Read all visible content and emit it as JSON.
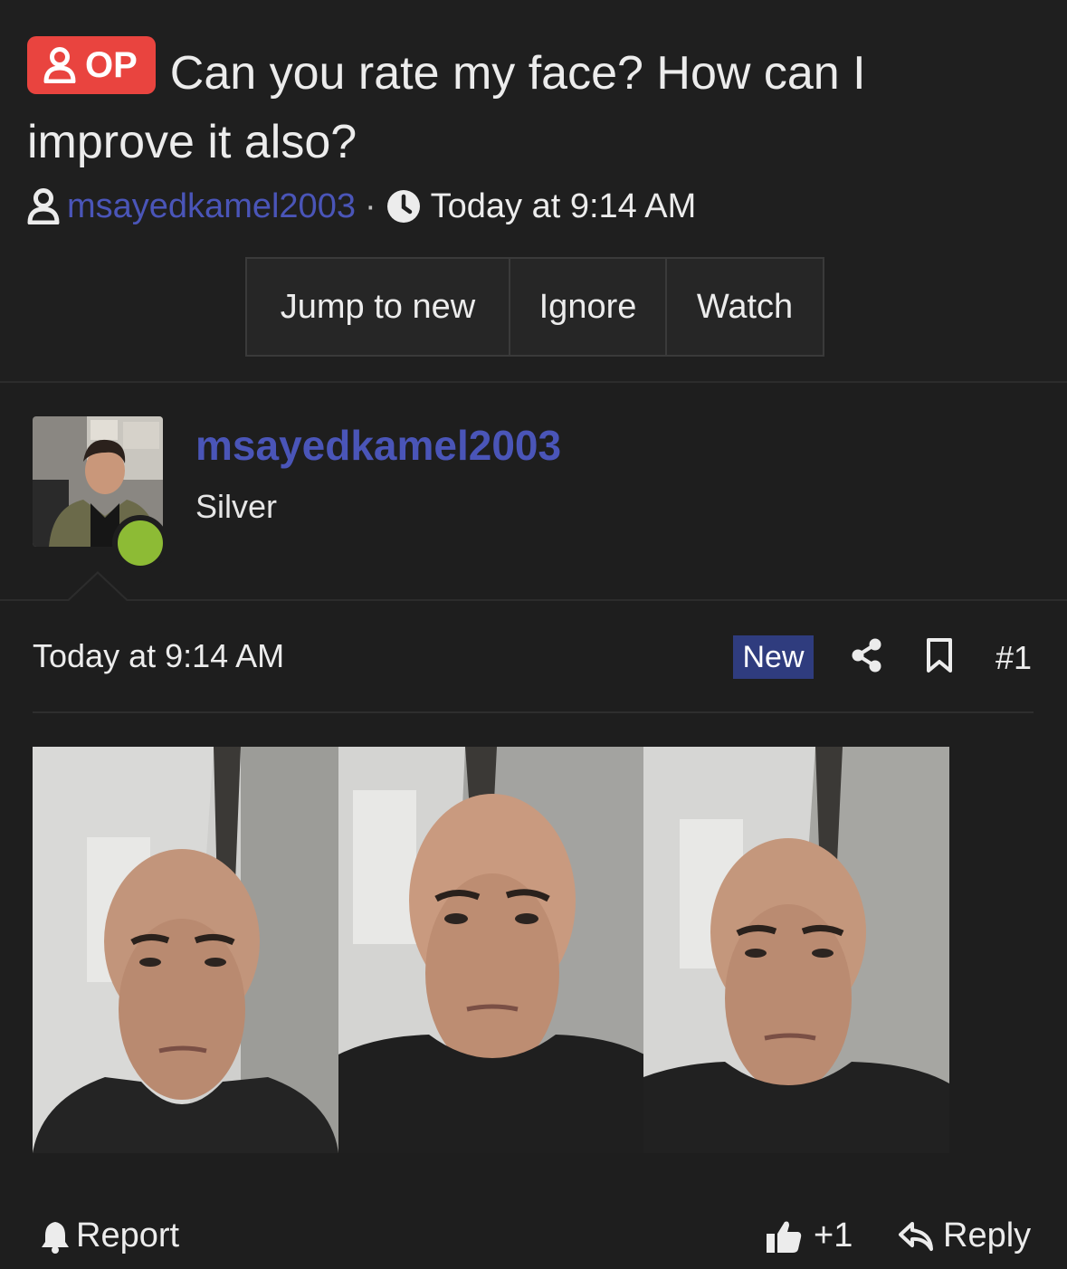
{
  "thread": {
    "op_badge": "OP",
    "title": "Can you rate my face? How can I improve it also?",
    "author": "msayedkamel2003",
    "separator": "·",
    "time": "Today at 9:14 AM"
  },
  "actions": {
    "jump": "Jump to new",
    "ignore": "Ignore",
    "watch": "Watch"
  },
  "post": {
    "username": "msayedkamel2003",
    "user_title": "Silver",
    "date": "Today at 9:14 AM",
    "new_badge": "New",
    "number": "#1",
    "online_color": "#8dbb35"
  },
  "footer": {
    "report": "Report",
    "like_count": "+1",
    "reply": "Reply"
  },
  "icons": [
    "user-icon",
    "clock-icon",
    "share-icon",
    "bookmark-icon",
    "bell-icon",
    "thumbs-up-icon",
    "reply-arrow-icon"
  ],
  "colors": {
    "accent": "#4a55b8",
    "op_badge": "#e9443f",
    "new_badge": "#2f3c7e",
    "background": "#1e1e1e"
  }
}
